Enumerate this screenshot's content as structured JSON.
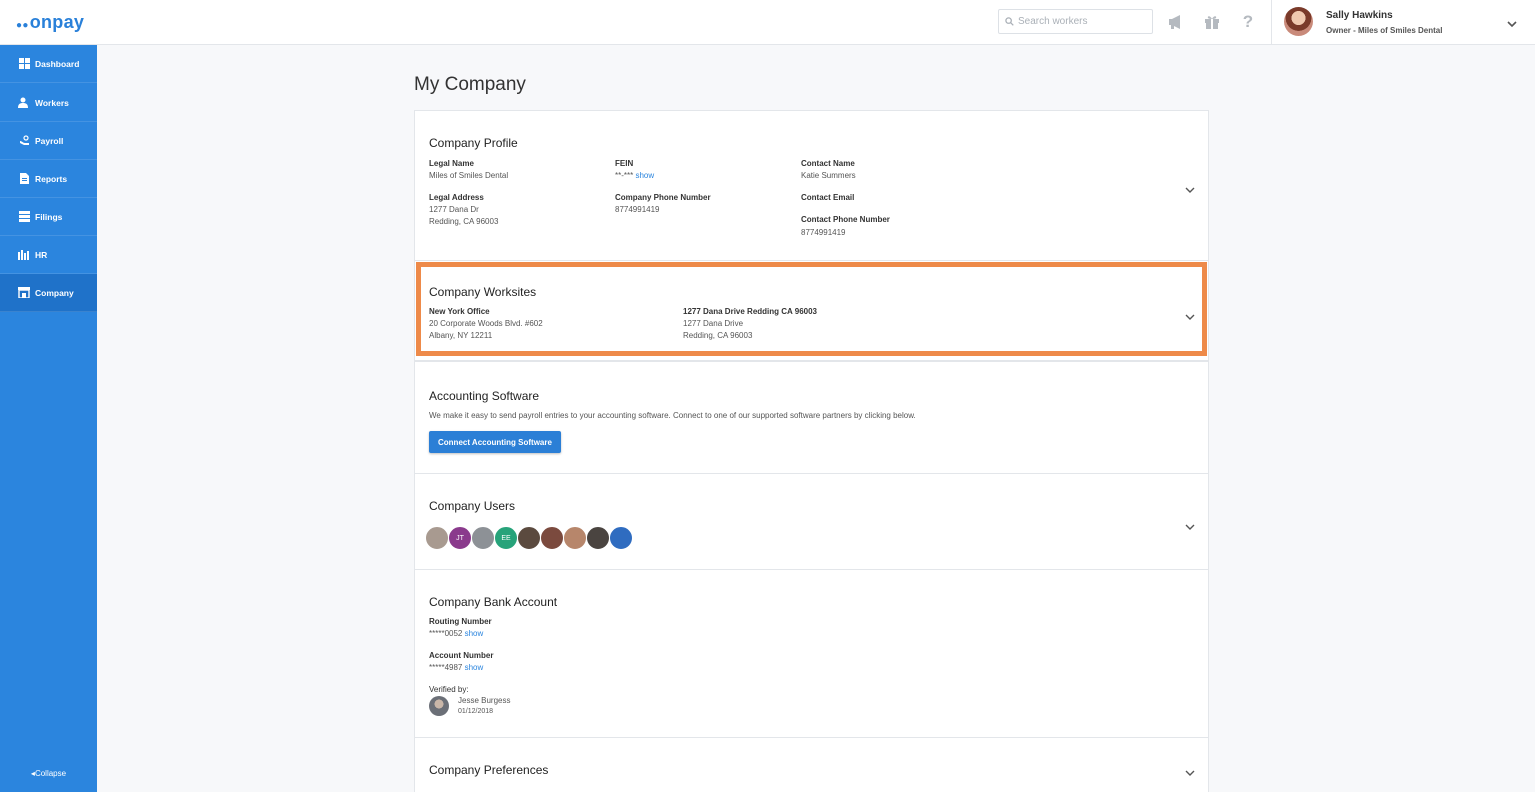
{
  "brand": {
    "logo_text": "onpay",
    "accent": "#2b85de",
    "highlight": "#ee8a49"
  },
  "header": {
    "search_placeholder": "Search workers",
    "icons": [
      "megaphone-icon",
      "gift-icon",
      "help-icon"
    ],
    "user": {
      "name": "Sally Hawkins",
      "role": "Owner - Miles of Smiles Dental"
    }
  },
  "sidebar": {
    "items": [
      {
        "label": "Dashboard",
        "icon": "dashboard-icon"
      },
      {
        "label": "Workers",
        "icon": "workers-icon"
      },
      {
        "label": "Payroll",
        "icon": "payroll-icon"
      },
      {
        "label": "Reports",
        "icon": "reports-icon"
      },
      {
        "label": "Filings",
        "icon": "filings-icon"
      },
      {
        "label": "HR",
        "icon": "hr-icon"
      },
      {
        "label": "Company",
        "icon": "company-icon",
        "active": true
      }
    ],
    "collapse_label": "Collapse"
  },
  "page": {
    "title": "My Company"
  },
  "profile": {
    "title": "Company Profile",
    "legal_name_label": "Legal Name",
    "legal_name": "Miles of Smiles Dental",
    "fein_label": "FEIN",
    "fein_masked": "**-***",
    "fein_show": "show",
    "contact_name_label": "Contact Name",
    "contact_name": "Katie Summers",
    "legal_address_label": "Legal Address",
    "legal_address_line1": "1277 Dana Dr",
    "legal_address_line2": "Redding, CA 96003",
    "phone_label": "Company Phone Number",
    "phone": "8774991419",
    "contact_email_label": "Contact Email",
    "contact_phone_label": "Contact Phone Number",
    "contact_phone": "8774991419"
  },
  "worksites": {
    "title": "Company Worksites",
    "sites": [
      {
        "name": "New York Office",
        "line1": "20 Corporate Woods Blvd. #602",
        "line2": "Albany, NY 12211"
      },
      {
        "name": "1277 Dana Drive Redding CA 96003",
        "line1": "1277 Dana Drive",
        "line2": "Redding, CA 96003"
      }
    ]
  },
  "accounting": {
    "title": "Accounting Software",
    "description": "We make it easy to send payroll entries to your accounting software. Connect to one of our supported software partners by clicking below.",
    "button_label": "Connect Accounting Software"
  },
  "users": {
    "title": "Company Users",
    "avatars": [
      {
        "initials": "",
        "color": "#a89a90"
      },
      {
        "initials": "JT",
        "color": "#8a3a8c"
      },
      {
        "initials": "",
        "color": "#8d9196"
      },
      {
        "initials": "EE",
        "color": "#27a37a"
      },
      {
        "initials": "",
        "color": "#5b4a3f"
      },
      {
        "initials": "",
        "color": "#7b4a3e"
      },
      {
        "initials": "",
        "color": "#b7866b"
      },
      {
        "initials": "",
        "color": "#4a4440"
      },
      {
        "initials": "",
        "color": "#2f6cc0"
      }
    ]
  },
  "bank": {
    "title": "Company Bank Account",
    "routing_label": "Routing Number",
    "routing_masked": "*****0052",
    "account_label": "Account Number",
    "account_masked": "*****4987",
    "show": "show",
    "verified_label": "Verified by:",
    "verifier_name": "Jesse Burgess",
    "verified_date": "01/12/2018"
  },
  "preferences": {
    "title": "Company Preferences"
  }
}
